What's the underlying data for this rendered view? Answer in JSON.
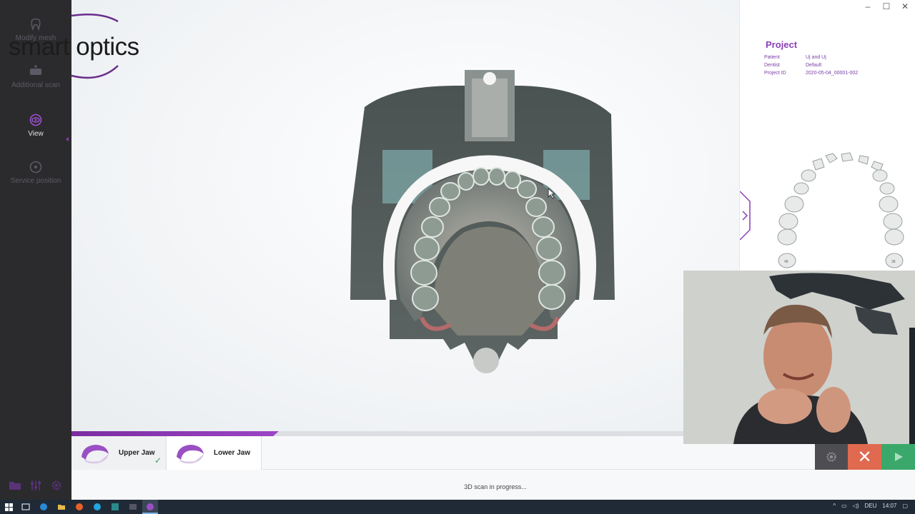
{
  "sidebar": {
    "items": [
      {
        "label": "Modify mesh",
        "icon": "tooth-icon",
        "active": false
      },
      {
        "label": "Additional scan",
        "icon": "scanner-plus-icon",
        "active": false
      },
      {
        "label": "View",
        "icon": "eye-icon",
        "active": true
      },
      {
        "label": "Service position",
        "icon": "crosshair-icon",
        "active": false
      }
    ],
    "bottom_icons": [
      "folder-icon",
      "sliders-icon",
      "gear-icon"
    ]
  },
  "logo": {
    "text": "smart optics"
  },
  "project": {
    "title": "Project",
    "rows": [
      {
        "key": "Patient",
        "value": "Uj and Uj"
      },
      {
        "key": "Dentist",
        "value": "Default"
      },
      {
        "key": "Project ID",
        "value": "2020-05-04_00001-002"
      }
    ]
  },
  "jaws": {
    "upper_label": "Upper Jaw",
    "upper_done": true,
    "lower_label": "Lower Jaw"
  },
  "scan": {
    "progress": 0.33,
    "status": "3D scan in progress..."
  },
  "tooth_chart": {
    "label_left": "48",
    "label_right": "38"
  },
  "taskbar": {
    "language": "DEU",
    "time": "14:07"
  },
  "colors": {
    "accent": "#8a3fb3",
    "close": "#e06a50",
    "next": "#3aa86a",
    "sidebar": "#2b2b2d"
  }
}
